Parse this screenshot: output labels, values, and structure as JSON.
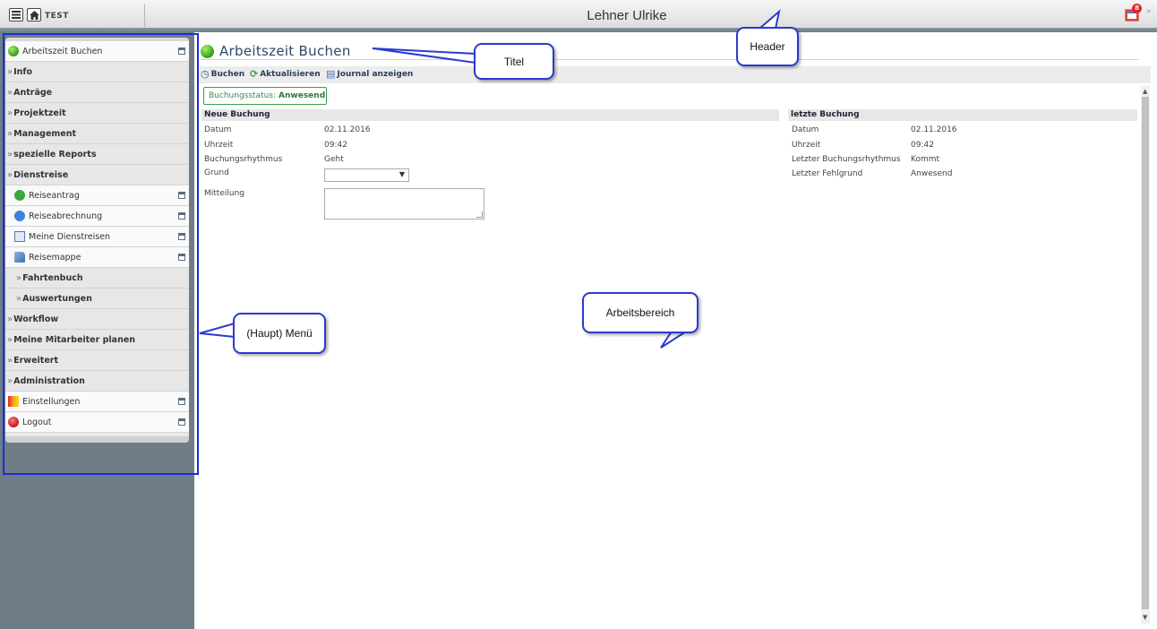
{
  "header": {
    "app_name": "TEST",
    "user_name": "Lehner Ulrike",
    "notification_count": "8",
    "icons": [
      "hamburger-menu-icon",
      "home-icon",
      "notification-icon",
      "chevron-down-icon"
    ]
  },
  "sidebar": {
    "items": [
      {
        "label": "Arbeitszeit Buchen",
        "kind": "leaf",
        "icon": "green-ball-icon"
      },
      {
        "label": "Info",
        "kind": "category"
      },
      {
        "label": "Anträge",
        "kind": "category"
      },
      {
        "label": "Projektzeit",
        "kind": "category"
      },
      {
        "label": "Management",
        "kind": "category"
      },
      {
        "label": "spezielle Reports",
        "kind": "category"
      },
      {
        "label": "Dienstreise",
        "kind": "category-expanded"
      },
      {
        "label": "Reiseantrag",
        "kind": "leaf",
        "icon": "green-arrow-icon"
      },
      {
        "label": "Reiseabrechnung",
        "kind": "leaf",
        "icon": "blue-arrow-icon"
      },
      {
        "label": "Meine Dienstreisen",
        "kind": "leaf",
        "icon": "calendar-icon"
      },
      {
        "label": "Reisemappe",
        "kind": "leaf",
        "icon": "folder-icon"
      },
      {
        "label": "Fahrtenbuch",
        "kind": "subcategory"
      },
      {
        "label": "Auswertungen",
        "kind": "subcategory"
      },
      {
        "label": "Workflow",
        "kind": "category"
      },
      {
        "label": "Meine Mitarbeiter planen",
        "kind": "category"
      },
      {
        "label": "Erweitert",
        "kind": "category"
      },
      {
        "label": "Administration",
        "kind": "category"
      },
      {
        "label": "Einstellungen",
        "kind": "leaf",
        "icon": "color-palette-icon"
      },
      {
        "label": "Logout",
        "kind": "leaf",
        "icon": "power-icon"
      }
    ]
  },
  "main": {
    "title": "Arbeitszeit Buchen",
    "toolbar": {
      "buchen": "Buchen",
      "aktualisieren": "Aktualisieren",
      "journal": "Journal anzeigen"
    },
    "status": {
      "label": "Buchungsstatus:",
      "value": "Anwesend"
    },
    "neue_buchung": {
      "heading": "Neue Buchung",
      "rows": [
        {
          "label": "Datum",
          "value": "02.11.2016"
        },
        {
          "label": "Uhrzeit",
          "value": "09:42"
        },
        {
          "label": "Buchungsrhythmus",
          "value": "Geht"
        }
      ],
      "grund_label": "Grund",
      "grund_value": "",
      "mitteilung_label": "Mitteilung",
      "mitteilung_value": ""
    },
    "letzte_buchung": {
      "heading": "letzte Buchung",
      "rows": [
        {
          "label": "Datum",
          "value": "02.11.2016"
        },
        {
          "label": "Uhrzeit",
          "value": "09:42"
        },
        {
          "label": "Letzter Buchungsrhythmus",
          "value": "Kommt"
        },
        {
          "label": "Letzter Fehlgrund",
          "value": "Anwesend"
        }
      ]
    }
  },
  "annotations": {
    "header": "Header",
    "titel": "Titel",
    "menu": "(Haupt) Menü",
    "arbeitsbereich": "Arbeitsbereich"
  },
  "colors": {
    "header_strip": "#6f7d85",
    "sidebar_bg": "#6f7e86",
    "title_text": "#2a4a6a",
    "status_green": "#3aa04a",
    "annotation_blue": "#2a3bd0"
  }
}
